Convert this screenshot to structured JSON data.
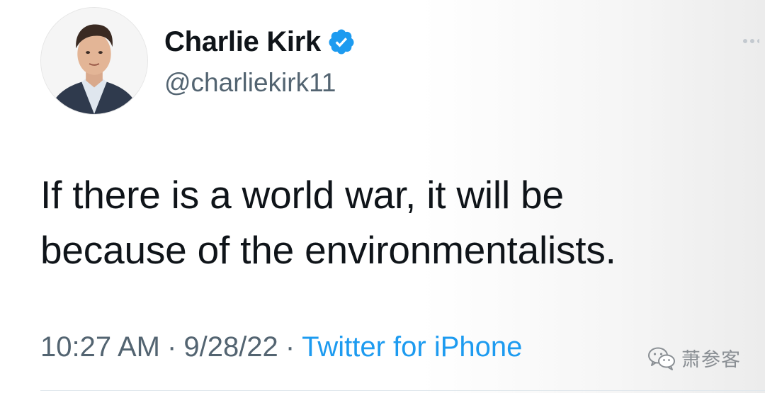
{
  "tweet": {
    "author": {
      "display_name": "Charlie Kirk",
      "handle": "@charliekirk11",
      "verified": true,
      "avatar_icon": "profile-photo"
    },
    "text_lines": [
      "If there is a world war, it will be",
      "because of the environmentalists."
    ],
    "meta": {
      "time": "10:27 AM",
      "separator": "·",
      "date": "9/28/22",
      "source": "Twitter for iPhone"
    }
  },
  "watermark": {
    "icon": "wechat-icon",
    "text": "萧参客"
  },
  "colors": {
    "text_primary": "#0f1419",
    "text_secondary": "#536471",
    "link_blue": "#1d9bf0",
    "verified_blue": "#1d9bf0"
  }
}
